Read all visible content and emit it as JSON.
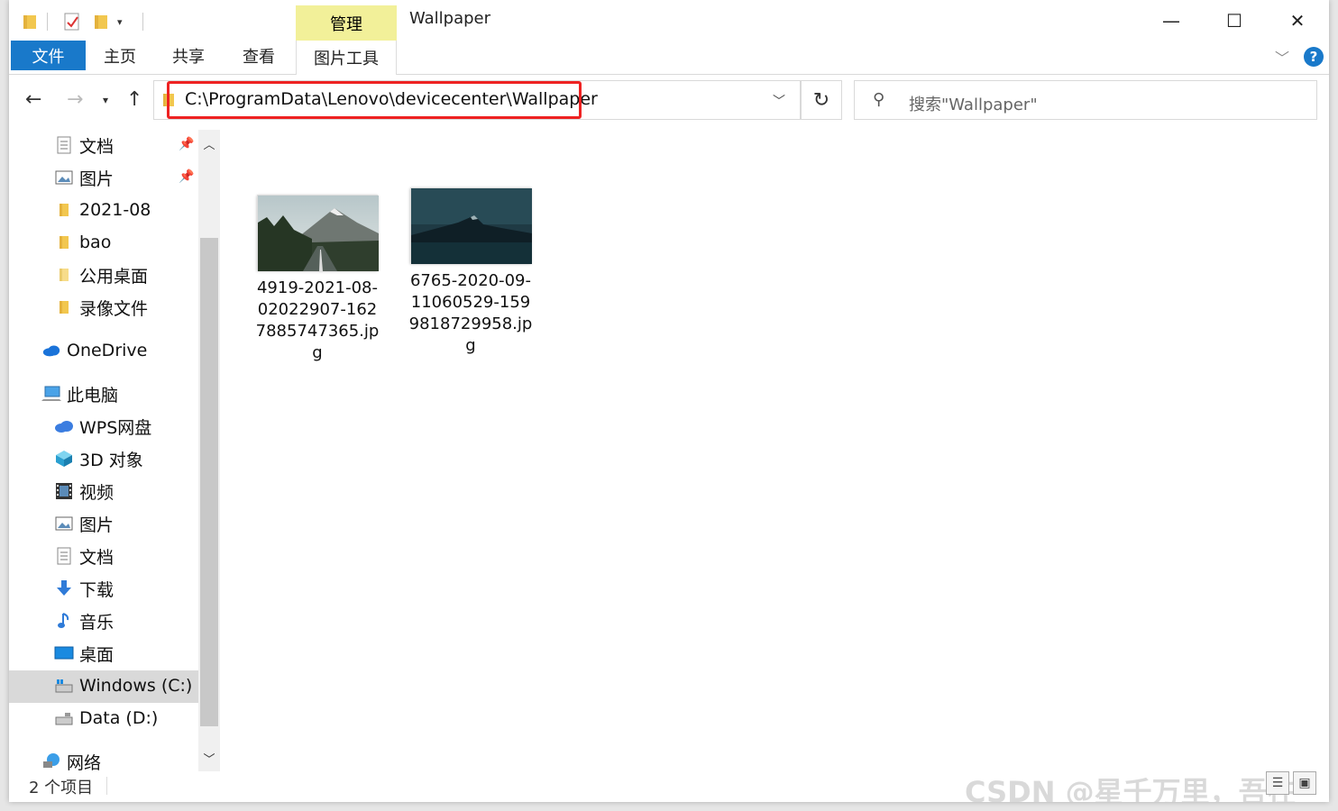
{
  "window": {
    "title": "Wallpaper",
    "manage_tab": "管理",
    "minimize_glyph": "—",
    "maximize_glyph": "☐",
    "close_glyph": "✕"
  },
  "ribbon": {
    "tabs": [
      {
        "label": "文件"
      },
      {
        "label": "主页"
      },
      {
        "label": "共享"
      },
      {
        "label": "查看"
      },
      {
        "label": "图片工具"
      }
    ],
    "help": "?"
  },
  "nav": {
    "address": "C:\\ProgramData\\Lenovo\\devicecenter\\Wallpaper",
    "search_placeholder": "搜索\"Wallpaper\""
  },
  "sidebar": {
    "items": [
      {
        "label": "文档",
        "icon": "document-icon",
        "pinned": true
      },
      {
        "label": "图片",
        "icon": "pictures-icon",
        "pinned": true
      },
      {
        "label": "2021-08",
        "icon": "folder-icon"
      },
      {
        "label": "bao",
        "icon": "folder-icon"
      },
      {
        "label": "公用桌面",
        "icon": "folder-icon"
      },
      {
        "label": "录像文件",
        "icon": "folder-icon"
      },
      {
        "label": "OneDrive",
        "icon": "onedrive-icon"
      },
      {
        "label": "此电脑",
        "icon": "computer-icon"
      },
      {
        "label": "WPS网盘",
        "icon": "wps-cloud-icon"
      },
      {
        "label": "3D 对象",
        "icon": "3d-objects-icon"
      },
      {
        "label": "视频",
        "icon": "videos-icon"
      },
      {
        "label": "图片",
        "icon": "pictures-icon"
      },
      {
        "label": "文档",
        "icon": "document-icon"
      },
      {
        "label": "下载",
        "icon": "download-icon"
      },
      {
        "label": "音乐",
        "icon": "music-icon"
      },
      {
        "label": "桌面",
        "icon": "desktop-icon"
      },
      {
        "label": "Windows (C:)",
        "icon": "drive-c-icon",
        "selected": true
      },
      {
        "label": "Data (D:)",
        "icon": "drive-d-icon"
      },
      {
        "label": "网络",
        "icon": "network-icon"
      }
    ]
  },
  "files": [
    {
      "name": "4919-2021-08-02022907-1627885747365.jpg"
    },
    {
      "name": "6765-2020-09-11060529-1599818729958.jpg"
    }
  ],
  "status": {
    "item_count": "2 个项目"
  },
  "watermark": "CSDN @星千万里，吾在"
}
